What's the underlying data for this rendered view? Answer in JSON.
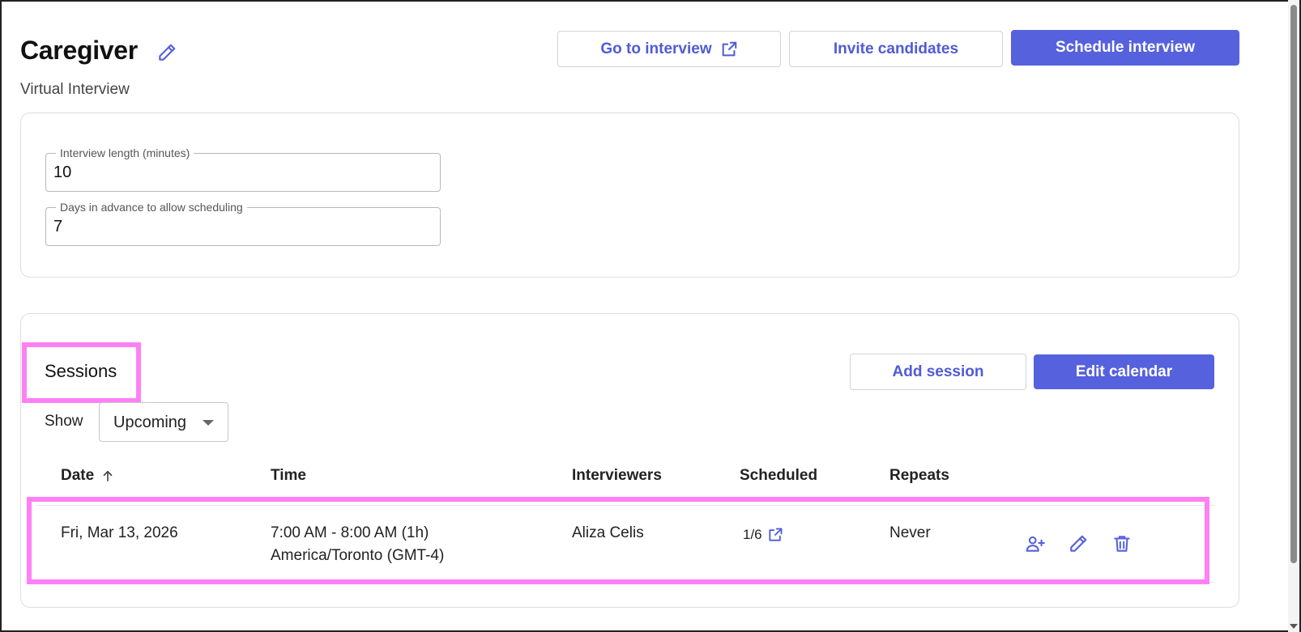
{
  "header": {
    "title": "Caregiver",
    "title_edit_icon": "pencil-icon",
    "subtitle": "Virtual Interview",
    "buttons": {
      "go_to_interview": "Go to interview",
      "go_to_interview_icon": "external-link-icon",
      "invite_candidates": "Invite candidates",
      "schedule_interview": "Schedule interview"
    }
  },
  "settings": {
    "interview_length": {
      "label": "Interview length (minutes)",
      "value": "10"
    },
    "days_in_advance": {
      "label": "Days in advance to allow scheduling",
      "value": "7"
    }
  },
  "sessions": {
    "title": "Sessions",
    "add_session": "Add session",
    "edit_calendar": "Edit calendar",
    "show_label": "Show",
    "show_value": "Upcoming",
    "columns": {
      "date": "Date",
      "time": "Time",
      "interviewers": "Interviewers",
      "scheduled": "Scheduled",
      "repeats": "Repeats"
    },
    "sort_icon": "arrow-up-icon",
    "rows": [
      {
        "date": "Fri, Mar 13, 2026",
        "time_line1": "7:00 AM - 8:00 AM (1h)",
        "time_line2": "America/Toronto (GMT-4)",
        "interviewers": "Aliza Celis",
        "scheduled": "1/6",
        "repeats": "Never",
        "actions": [
          "add-person-icon",
          "pencil-icon",
          "trash-icon"
        ]
      }
    ]
  },
  "colors": {
    "accent": "#5661dd",
    "accent_text": "#4f5bd5",
    "highlight": "#ff80f5"
  }
}
